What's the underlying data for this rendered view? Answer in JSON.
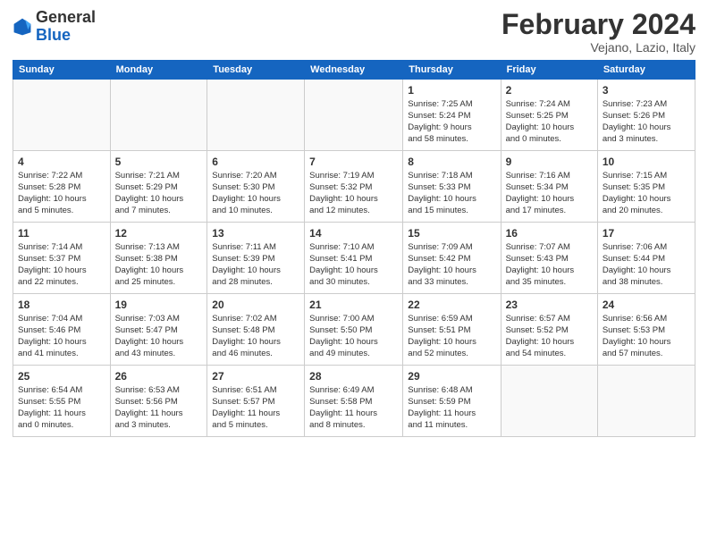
{
  "header": {
    "logo_general": "General",
    "logo_blue": "Blue",
    "month_title": "February 2024",
    "location": "Vejano, Lazio, Italy"
  },
  "days_of_week": [
    "Sunday",
    "Monday",
    "Tuesday",
    "Wednesday",
    "Thursday",
    "Friday",
    "Saturday"
  ],
  "weeks": [
    [
      {
        "day": "",
        "info": ""
      },
      {
        "day": "",
        "info": ""
      },
      {
        "day": "",
        "info": ""
      },
      {
        "day": "",
        "info": ""
      },
      {
        "day": "1",
        "info": "Sunrise: 7:25 AM\nSunset: 5:24 PM\nDaylight: 9 hours\nand 58 minutes."
      },
      {
        "day": "2",
        "info": "Sunrise: 7:24 AM\nSunset: 5:25 PM\nDaylight: 10 hours\nand 0 minutes."
      },
      {
        "day": "3",
        "info": "Sunrise: 7:23 AM\nSunset: 5:26 PM\nDaylight: 10 hours\nand 3 minutes."
      }
    ],
    [
      {
        "day": "4",
        "info": "Sunrise: 7:22 AM\nSunset: 5:28 PM\nDaylight: 10 hours\nand 5 minutes."
      },
      {
        "day": "5",
        "info": "Sunrise: 7:21 AM\nSunset: 5:29 PM\nDaylight: 10 hours\nand 7 minutes."
      },
      {
        "day": "6",
        "info": "Sunrise: 7:20 AM\nSunset: 5:30 PM\nDaylight: 10 hours\nand 10 minutes."
      },
      {
        "day": "7",
        "info": "Sunrise: 7:19 AM\nSunset: 5:32 PM\nDaylight: 10 hours\nand 12 minutes."
      },
      {
        "day": "8",
        "info": "Sunrise: 7:18 AM\nSunset: 5:33 PM\nDaylight: 10 hours\nand 15 minutes."
      },
      {
        "day": "9",
        "info": "Sunrise: 7:16 AM\nSunset: 5:34 PM\nDaylight: 10 hours\nand 17 minutes."
      },
      {
        "day": "10",
        "info": "Sunrise: 7:15 AM\nSunset: 5:35 PM\nDaylight: 10 hours\nand 20 minutes."
      }
    ],
    [
      {
        "day": "11",
        "info": "Sunrise: 7:14 AM\nSunset: 5:37 PM\nDaylight: 10 hours\nand 22 minutes."
      },
      {
        "day": "12",
        "info": "Sunrise: 7:13 AM\nSunset: 5:38 PM\nDaylight: 10 hours\nand 25 minutes."
      },
      {
        "day": "13",
        "info": "Sunrise: 7:11 AM\nSunset: 5:39 PM\nDaylight: 10 hours\nand 28 minutes."
      },
      {
        "day": "14",
        "info": "Sunrise: 7:10 AM\nSunset: 5:41 PM\nDaylight: 10 hours\nand 30 minutes."
      },
      {
        "day": "15",
        "info": "Sunrise: 7:09 AM\nSunset: 5:42 PM\nDaylight: 10 hours\nand 33 minutes."
      },
      {
        "day": "16",
        "info": "Sunrise: 7:07 AM\nSunset: 5:43 PM\nDaylight: 10 hours\nand 35 minutes."
      },
      {
        "day": "17",
        "info": "Sunrise: 7:06 AM\nSunset: 5:44 PM\nDaylight: 10 hours\nand 38 minutes."
      }
    ],
    [
      {
        "day": "18",
        "info": "Sunrise: 7:04 AM\nSunset: 5:46 PM\nDaylight: 10 hours\nand 41 minutes."
      },
      {
        "day": "19",
        "info": "Sunrise: 7:03 AM\nSunset: 5:47 PM\nDaylight: 10 hours\nand 43 minutes."
      },
      {
        "day": "20",
        "info": "Sunrise: 7:02 AM\nSunset: 5:48 PM\nDaylight: 10 hours\nand 46 minutes."
      },
      {
        "day": "21",
        "info": "Sunrise: 7:00 AM\nSunset: 5:50 PM\nDaylight: 10 hours\nand 49 minutes."
      },
      {
        "day": "22",
        "info": "Sunrise: 6:59 AM\nSunset: 5:51 PM\nDaylight: 10 hours\nand 52 minutes."
      },
      {
        "day": "23",
        "info": "Sunrise: 6:57 AM\nSunset: 5:52 PM\nDaylight: 10 hours\nand 54 minutes."
      },
      {
        "day": "24",
        "info": "Sunrise: 6:56 AM\nSunset: 5:53 PM\nDaylight: 10 hours\nand 57 minutes."
      }
    ],
    [
      {
        "day": "25",
        "info": "Sunrise: 6:54 AM\nSunset: 5:55 PM\nDaylight: 11 hours\nand 0 minutes."
      },
      {
        "day": "26",
        "info": "Sunrise: 6:53 AM\nSunset: 5:56 PM\nDaylight: 11 hours\nand 3 minutes."
      },
      {
        "day": "27",
        "info": "Sunrise: 6:51 AM\nSunset: 5:57 PM\nDaylight: 11 hours\nand 5 minutes."
      },
      {
        "day": "28",
        "info": "Sunrise: 6:49 AM\nSunset: 5:58 PM\nDaylight: 11 hours\nand 8 minutes."
      },
      {
        "day": "29",
        "info": "Sunrise: 6:48 AM\nSunset: 5:59 PM\nDaylight: 11 hours\nand 11 minutes."
      },
      {
        "day": "",
        "info": ""
      },
      {
        "day": "",
        "info": ""
      }
    ]
  ]
}
